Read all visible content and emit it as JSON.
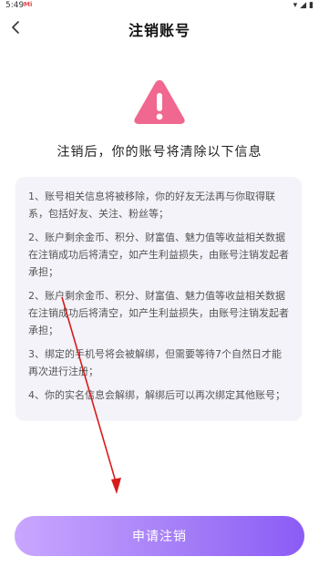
{
  "status_bar": {
    "time": "5:49",
    "carrier_badge": "Mi",
    "icons": [
      "wifi-icon",
      "signal-icon",
      "battery-icon"
    ]
  },
  "header": {
    "title": "注销账号",
    "back_icon": "chevron-left-icon"
  },
  "warning": {
    "icon": "warning-triangle-icon",
    "color": "#f0678f",
    "subtitle": "注销后，你的账号将清除以下信息"
  },
  "info_items": [
    "1、账号相关信息将被移除，你的好友无法再与你取得联系，包括好友、关注、粉丝等；",
    "2、账户剩余金币、积分、财富值、魅力值等收益相关数据在注销成功后将清空，如产生利益损失，由账号注销发起者承担；",
    "2、账户剩余金币、积分、财富值、魅力值等收益相关数据在注销成功后将清空，如产生利益损失，由账号注销发起者承担；",
    "3、绑定的手机号将会被解绑，但需要等待7个自然日才能再次进行注册；",
    "4、你的实名信息会解绑，解绑后可以再次绑定其他账号；"
  ],
  "action": {
    "button_label": "申请注销"
  }
}
